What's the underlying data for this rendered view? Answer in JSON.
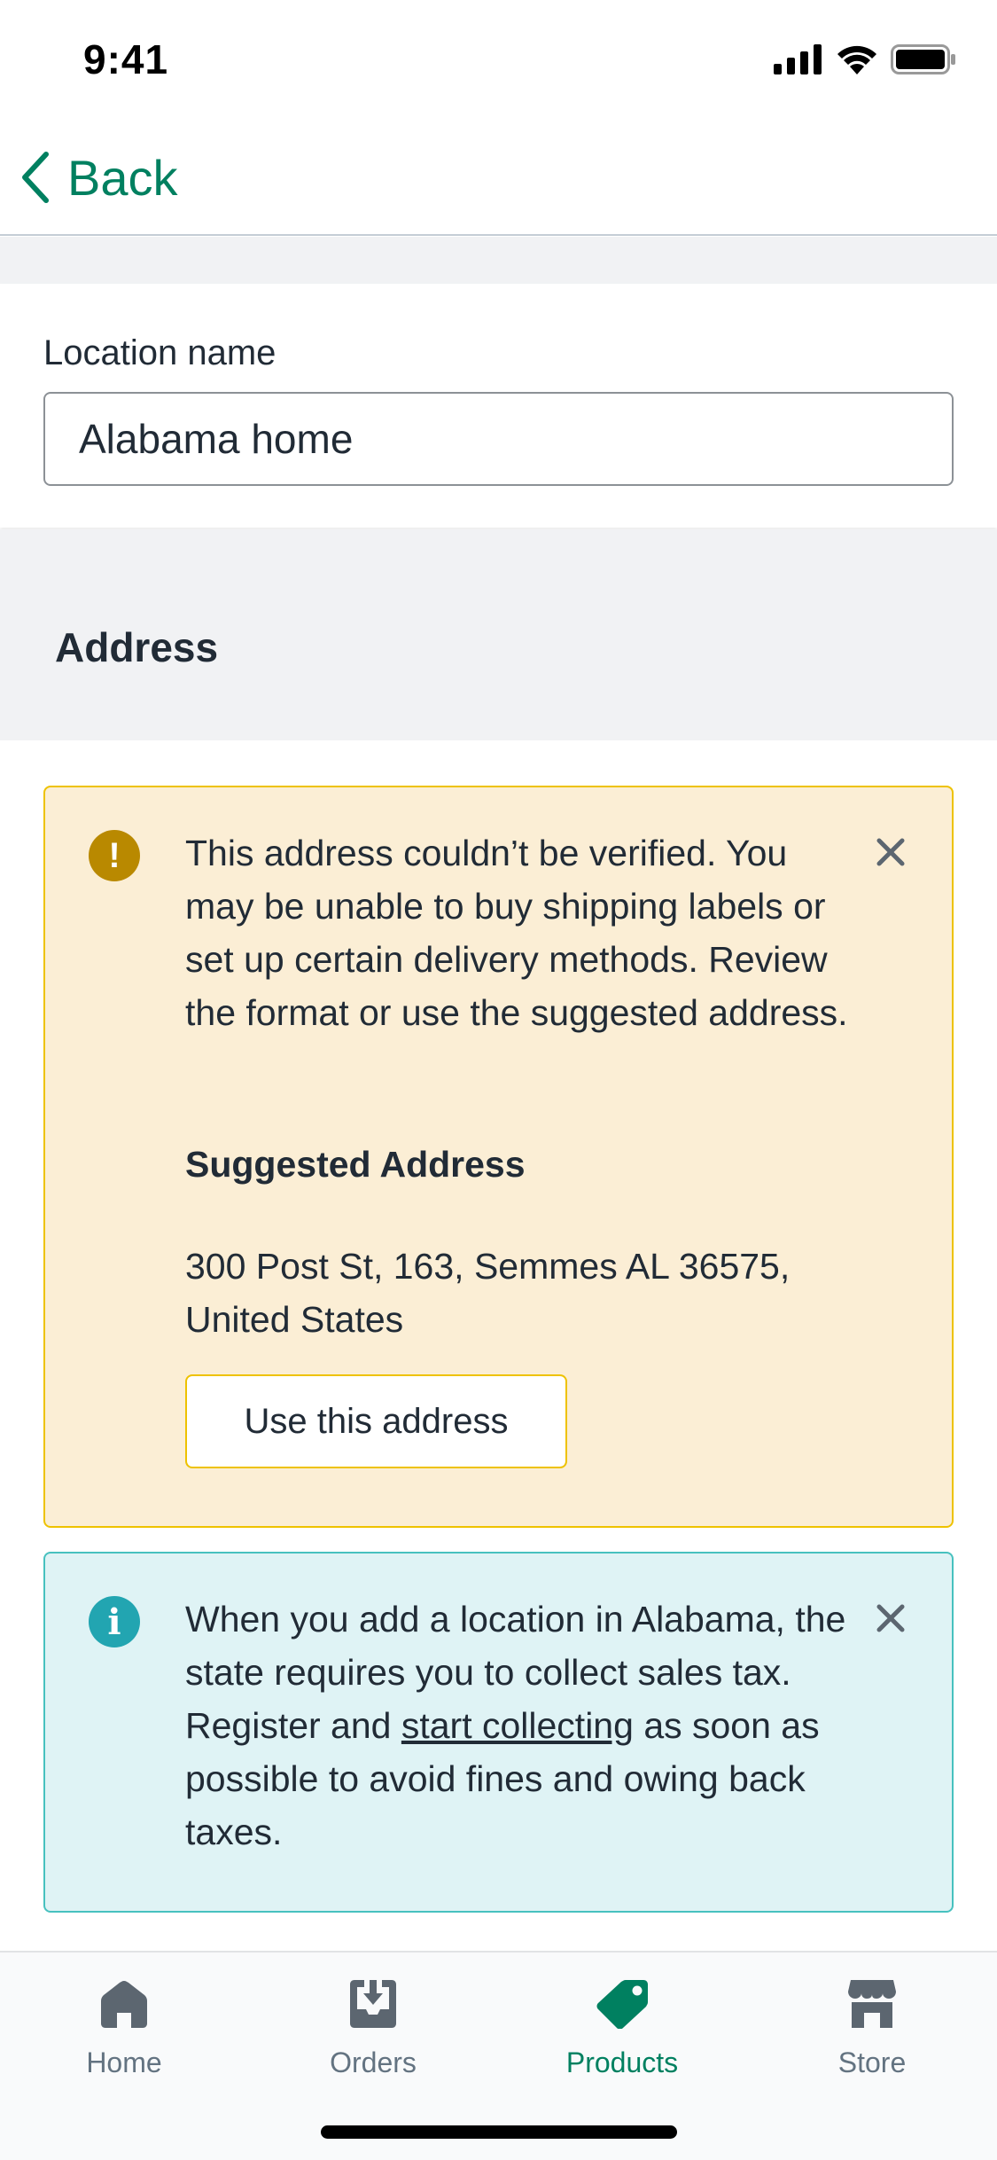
{
  "status_bar": {
    "time": "9:41"
  },
  "nav": {
    "back_label": "Back"
  },
  "location": {
    "label": "Location name",
    "value": "Alabama home"
  },
  "address_section": {
    "title": "Address"
  },
  "warning_banner": {
    "icon": "!",
    "message": "This address couldn’t be verified. You may be unable to buy shipping labels or set up certain delivery methods. Review the format or use the suggested address.",
    "suggested_title": "Suggested Address",
    "suggested_address": "300 Post St, 163, Semmes AL 36575, United States",
    "button_label": "Use this address",
    "color": "#b98900"
  },
  "info_banner": {
    "icon": "i",
    "text_before": "When you add a location in Alabama, the state requires you to collect sales tax. Register and ",
    "link_text": "start collecting",
    "text_after": " as soon as possible to avoid fines and owing back taxes.",
    "color": "#22a5b1"
  },
  "tabs": [
    {
      "label": "Home",
      "icon": "home-icon",
      "active": false
    },
    {
      "label": "Orders",
      "icon": "orders-icon",
      "active": false
    },
    {
      "label": "Products",
      "icon": "tag-icon",
      "active": true
    },
    {
      "label": "Store",
      "icon": "store-icon",
      "active": false
    }
  ],
  "colors": {
    "accent": "#008060",
    "warning_bg": "#fbeed5",
    "info_bg": "#dff3f5"
  }
}
